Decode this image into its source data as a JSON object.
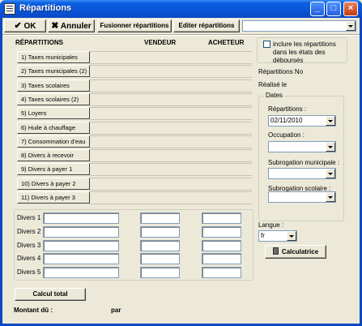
{
  "window": {
    "title": "Répartitions"
  },
  "toolbar": {
    "ok_label": "OK",
    "cancel_label": "Annuler",
    "merge_label": "Fusionner répartitions",
    "edit_label": "Editer répartitions"
  },
  "headers": {
    "repartitions": "RÉPARTITIONS",
    "vendeur": "VENDEUR",
    "acheteur": "ACHETEUR"
  },
  "repartitions": [
    "1) Taxes municipales",
    "2) Taxes municipales (2)",
    "3) Taxes scolaires",
    "4) Taxes scolaires (2)",
    "5) Loyers",
    "6) Huile à chauffage",
    "7) Consommation d'eau",
    "8) Divers à recevoir",
    "9) Divers à payer 1",
    "10) Divers à payer 2",
    "11) Divers à payer 3"
  ],
  "divers": [
    "Divers 1",
    "Divers 2",
    "Divers 3",
    "Divers 4",
    "Divers 5"
  ],
  "right": {
    "include_label": "inclure les répartitions dans les états des déboursés",
    "repartitions_no": "Répartitions No",
    "realise_le": "Réalisé le",
    "dates_group": "Dates",
    "repartitions_date_label": "Répartitions :",
    "repartitions_date_value": "02/11/2010",
    "occupation_label": "Occupation :",
    "subrog_municipale_label": "Subrogation municipale :",
    "subrog_scolaire_label": "Subrogation scolaire :",
    "langue_label": "Langue :",
    "langue_value": "fr",
    "calculatrice_label": "Calculatrice"
  },
  "footer": {
    "calcul_label": "Calcul total",
    "montant_label": "Montant dû :",
    "par_label": "par"
  },
  "icons": {
    "ok": "checkmark-icon",
    "cancel": "x-icon",
    "calculator": "calculator-icon"
  }
}
